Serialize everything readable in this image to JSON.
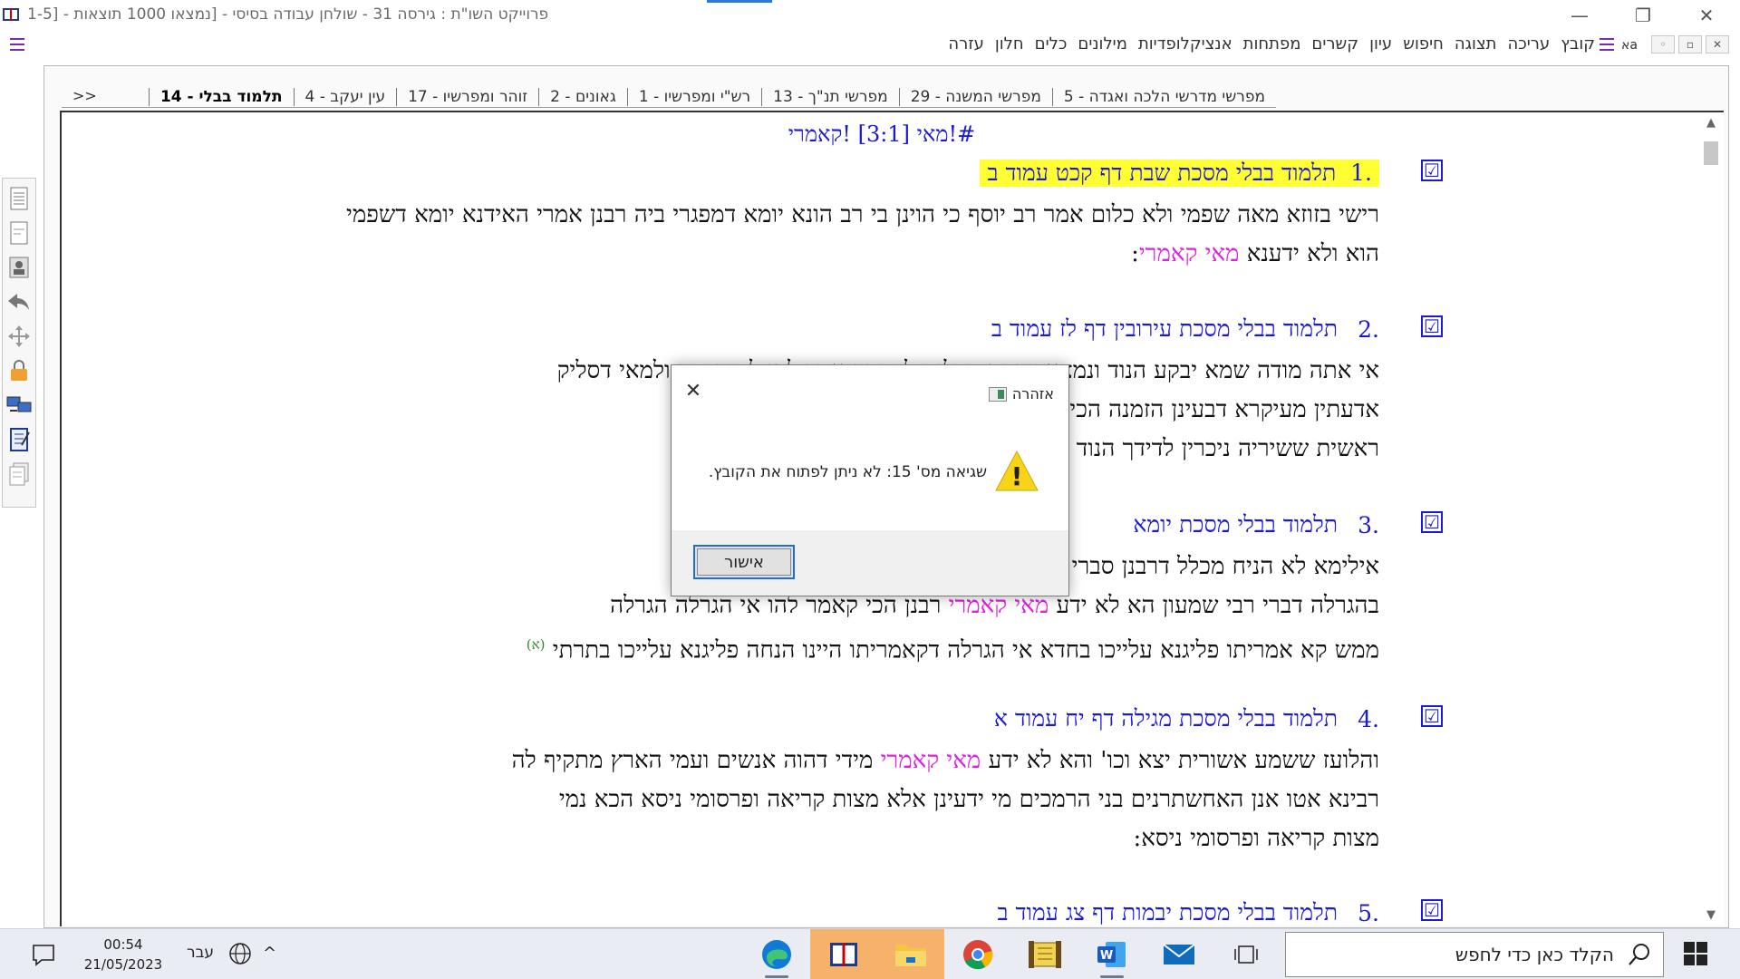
{
  "window": {
    "title": "פרוייקט השו\"ת  :  גירסה 31  -  שולחן עבודה בסיסי  - [נמצאו 1000 תוצאות  - [1-5",
    "minimize": "—",
    "restore": "❐",
    "close": "✕"
  },
  "menu": {
    "items": [
      "קובץ",
      "עריכה",
      "תצוגה",
      "חיפוש",
      "עיון",
      "קשרים",
      "מפתחות",
      "אנציקלופדיות",
      "מילונים",
      "כלים",
      "חלון",
      "עזרה"
    ],
    "mdi_buttons": [
      "◦",
      "▫",
      "✕"
    ]
  },
  "tabs": {
    "items": [
      "מפרשי מדרשי הלכה ואגדה - 5",
      "מפרשי המשנה - 29",
      "מפרשי תנ\"ך - 13",
      "רש\"י ומפרשיו - 1",
      "גאונים - 2",
      "זוהר ומפרשיו - 17",
      "עין יעקב - 4",
      "תלמוד בבלי - 14"
    ],
    "more": ">>"
  },
  "content": {
    "query_title": "#!מאי [3:1] !קאמרי",
    "results": [
      {
        "num": ".1",
        "ref": "תלמוד בבלי מסכת שבת דף קכט עמוד ב",
        "checked": "☑",
        "body_before": "רישי בזוזא מאה שפמי ולא כלום אמר רב יוסף כי הוינן בי רב הונא יומא דמפגרי ביה רבנן אמרי האידנא יומא דשפמי הוא ולא ידענא ",
        "keyword": "מאי קאמרי",
        "body_after": ":"
      },
      {
        "num": ".2",
        "ref": "תלמוד בבלי מסכת עירובין דף לז עמוד ב",
        "checked": "☑",
        "line1": "אי אתה מודה שמא יבקע הנוד ונמצא שותה טבלים למפרע אמר להן לכשיבקע ולמאי דסליק",
        "line2": "אדעתין מעיקרא דבעינן הזמנה הכי קאמרי ליה לדידן בעינן",
        "line3": "ראשית ששיריה ניכרין לדידך הנוד ונמצא שותה טבלים למפרע"
      },
      {
        "num": ".3",
        "ref": "תלמוד בבלי מסכת יומא",
        "checked": "☑",
        "line1": "אילימא לא הניח מכלל דרבנן סברי מת אחד מהן מביא חבירו שלא",
        "line2_before": "בהגרלה דברי רבי שמעון הא לא ידע ",
        "keyword": "מאי קאמרי",
        "line2_after": " רבנן הכי קאמר להו אי הגרלה הגרלה",
        "line3": "ממש קא אמריתו פליגנא עלייכו בחדא אי הגרלה דקאמריתו היינו הנחה פליגנא עלייכו בתרתי",
        "footnote": "(א)"
      },
      {
        "num": ".4",
        "ref": "תלמוד בבלי מסכת מגילה דף יח עמוד א",
        "checked": "☑",
        "line1_before": "והלועז ששמע אשורית יצא וכו' והא לא ידע ",
        "keyword": "מאי קאמרי",
        "line1_after": " מידי דהוה אנשים ועמי הארץ מתקיף לה",
        "line2": "רבינא אטו אנן האחשתרנים בני הרמכים מי ידעינן אלא מצות קריאה ופרסומי ניסא הכא נמי",
        "line3": "מצות קריאה ופרסומי ניסא:"
      },
      {
        "num": ".5",
        "ref": "תלמוד בבלי מסכת יבמות דף צג עמוד ב",
        "checked": "☑"
      }
    ]
  },
  "dialog": {
    "title": "אזהרה",
    "message": "שגיאה מס' 15: לא ניתן לפתוח את הקובץ.",
    "ok_label": "אישור",
    "close": "✕",
    "warning_mark": "!"
  },
  "taskbar": {
    "time": "00:54",
    "date": "21/05/2023",
    "language": "עבר",
    "chevron": "^",
    "search_placeholder": "הקלד כאן כדי לחפש",
    "apps": [
      "edge-icon",
      "shut-project-icon",
      "file-explorer-icon",
      "chrome-icon",
      "torah-app-icon",
      "word-icon",
      "mail-icon",
      "task-view-icon"
    ]
  },
  "colors": {
    "link_blue": "#1a1ad6",
    "highlight_yellow": "#ffff33",
    "keyword_magenta": "#e020e0",
    "active_app": "#f6b26b"
  }
}
